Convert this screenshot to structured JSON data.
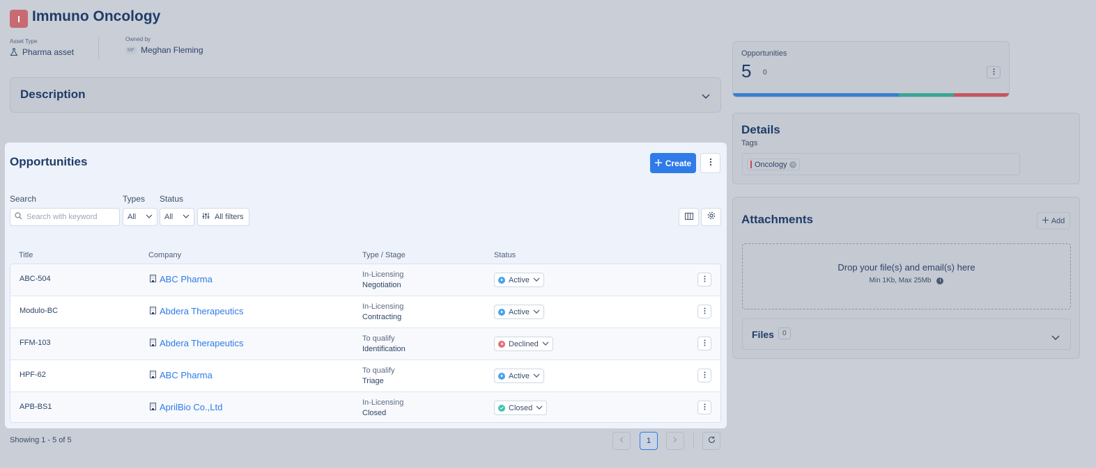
{
  "header": {
    "badge_letter": "I",
    "title": "Immuno Oncology",
    "asset_type_label": "Asset Type",
    "asset_type_value": "Pharma asset",
    "owned_by_label": "Owned by",
    "owner_initials": "MF",
    "owner_name": "Meghan Fleming"
  },
  "description": {
    "title": "Description"
  },
  "opportunities": {
    "title": "Opportunities",
    "create_label": "Create",
    "search_label": "Search",
    "search_placeholder": "Search with keyword",
    "types_label": "Types",
    "types_value": "All",
    "status_label": "Status",
    "status_value": "All",
    "all_filters_label": "All filters",
    "columns": [
      "Title",
      "Company",
      "Type / Stage",
      "Status"
    ],
    "rows": [
      {
        "title": "ABC-504",
        "company": "ABC Pharma",
        "type": "In-Licensing",
        "stage": "Negotiation",
        "status": "Active"
      },
      {
        "title": "Modulo-BC",
        "company": "Abdera Therapeutics",
        "type": "In-Licensing",
        "stage": "Contracting",
        "status": "Active"
      },
      {
        "title": "FFM-103",
        "company": "Abdera Therapeutics",
        "type": "To qualify",
        "stage": "Identification",
        "status": "Declined"
      },
      {
        "title": "HPF-62",
        "company": "ABC Pharma",
        "type": "To qualify",
        "stage": "Triage",
        "status": "Active"
      },
      {
        "title": "APB-BS1",
        "company": "AprilBio Co.,Ltd",
        "type": "In-Licensing",
        "stage": "Closed",
        "status": "Closed"
      }
    ],
    "showing": "Showing 1 - 5 of 5",
    "current_page": "1"
  },
  "status_colors": {
    "Active": "#4aa3e8",
    "Declined": "#e46a78",
    "Closed": "#3cc4b0"
  },
  "opportunity_stats": {
    "label": "Opportunities",
    "count": "5",
    "sub_count": "0",
    "bar_segments": [
      {
        "color": "#3a7fcf",
        "fraction": 0.6
      },
      {
        "color": "#3aa593",
        "fraction": 0.2
      },
      {
        "color": "#c65560",
        "fraction": 0.2
      }
    ]
  },
  "details": {
    "title": "Details",
    "tags_label": "Tags",
    "tags": [
      "Oncology"
    ]
  },
  "attachments": {
    "title": "Attachments",
    "add_label": "Add",
    "drop_text": "Drop your file(s) and email(s) here",
    "drop_limits": "Min 1Kb, Max 25Mb",
    "files_label": "Files",
    "files_count": "0"
  }
}
